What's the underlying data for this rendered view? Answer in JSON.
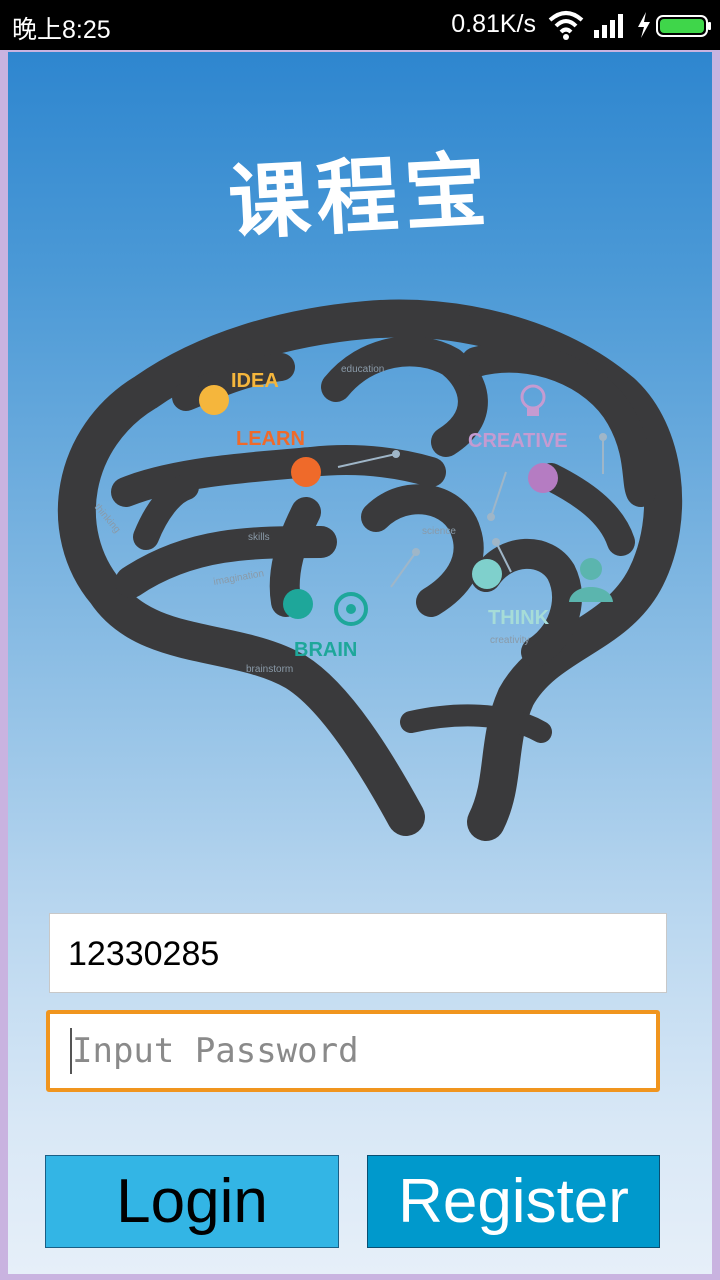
{
  "status_bar": {
    "time": "晚上8:25",
    "net_speed": "0.81K/s",
    "icons": [
      "wifi-icon",
      "signal-icon",
      "charging-icon",
      "battery-icon"
    ]
  },
  "app": {
    "title": "课程宝",
    "illustration": {
      "labels": {
        "idea": "IDEA",
        "learn": "LEARN",
        "creative": "CREATIVE",
        "brain": "BRAIN",
        "think": "THINK",
        "education": "education",
        "thinking": "thinking",
        "skills": "skills",
        "imagination": "imagination",
        "science": "science",
        "creativity": "creativity",
        "brainstorm": "brainstorm"
      },
      "colors": {
        "brain": "#3a3a3c",
        "idea": "#f5b63c",
        "learn": "#ef6a2a",
        "creative": "#b57cc2",
        "brain_accent": "#1ea79a",
        "think": "#7fd0cc"
      }
    },
    "username_value": "12330285",
    "password_placeholder": "Input Password",
    "login_label": "Login",
    "register_label": "Register"
  }
}
